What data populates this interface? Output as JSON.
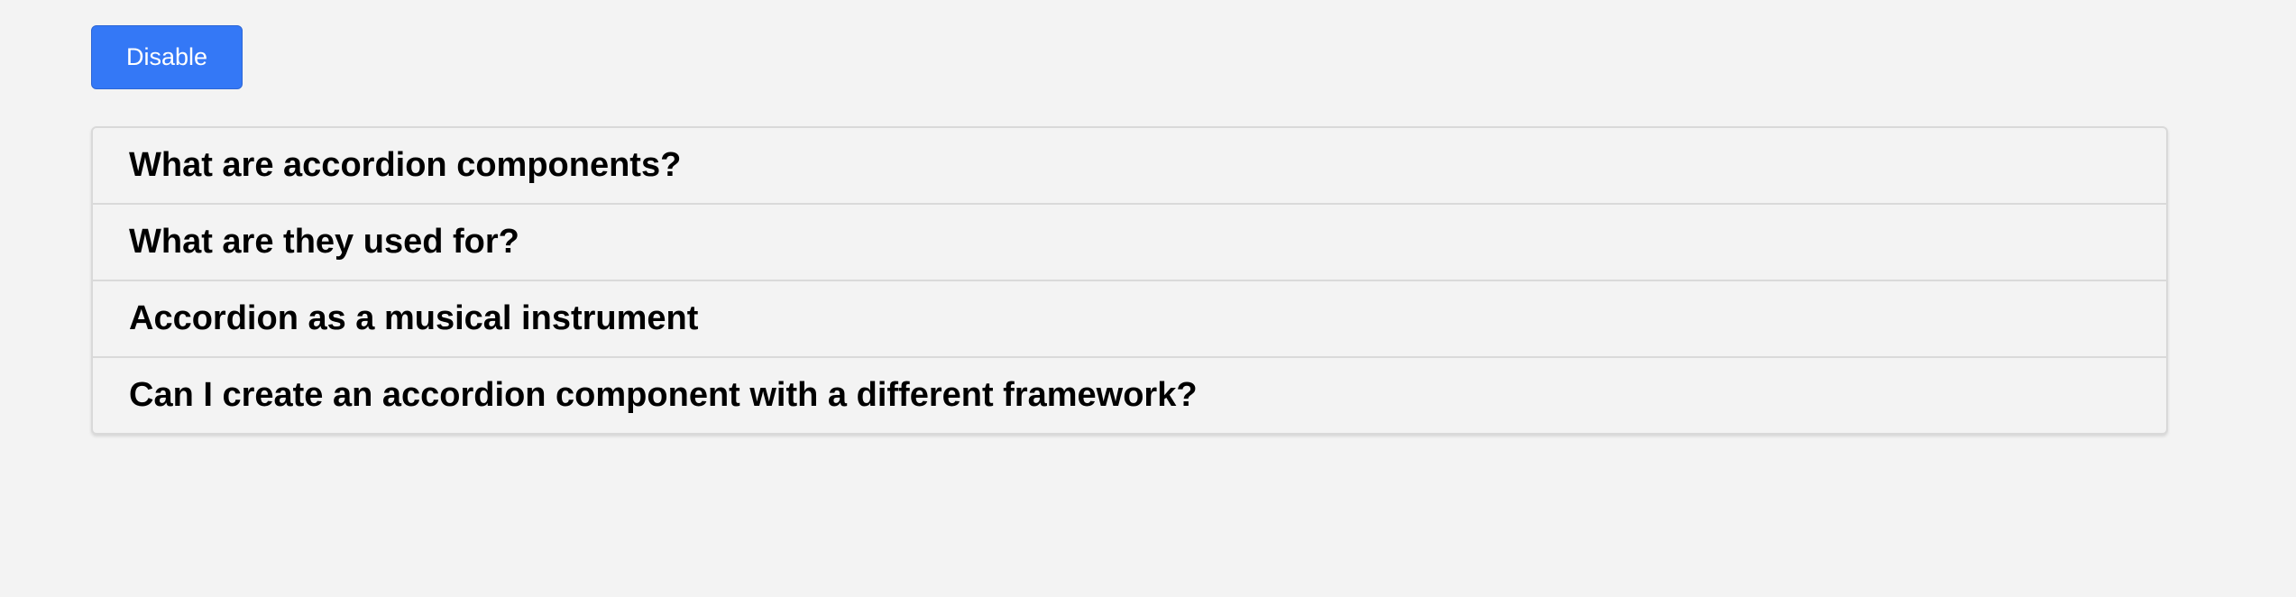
{
  "toolbar": {
    "toggle_label": "Disable"
  },
  "accordion": {
    "items": [
      {
        "title": "What are accordion components?"
      },
      {
        "title": "What are they used for?"
      },
      {
        "title": "Accordion as a musical instrument"
      },
      {
        "title": "Can I create an accordion component with a different framework?"
      }
    ]
  },
  "colors": {
    "background": "#f3f3f3",
    "button": "#3478f6",
    "border": "#d9d9d9"
  }
}
